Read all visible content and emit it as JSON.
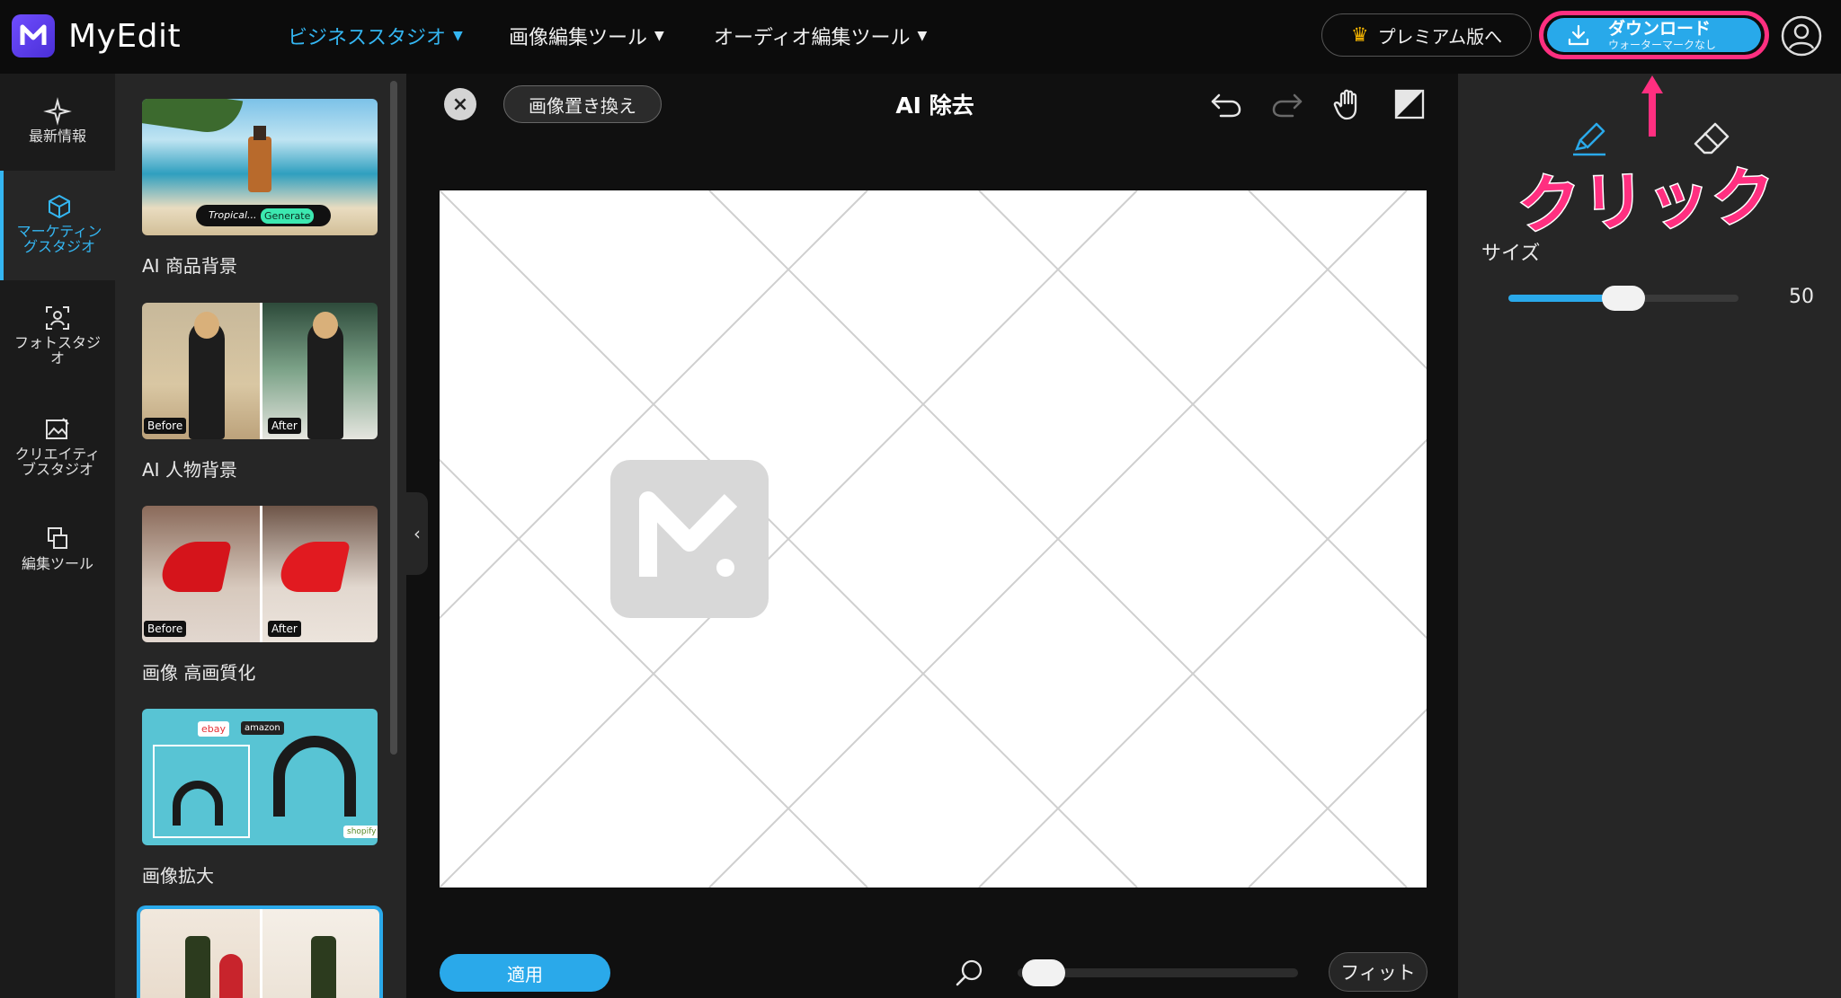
{
  "header": {
    "brand": "MyEdit",
    "nav": [
      {
        "label": "ビジネススタジオ",
        "active": true
      },
      {
        "label": "画像編集ツール"
      },
      {
        "label": "オーディオ編集ツール"
      }
    ],
    "premium_label": "プレミアム版へ",
    "download_label": "ダウンロード",
    "download_sub": "ウォーターマークなし"
  },
  "rail": [
    {
      "label": "最新情報",
      "icon": "sparkle-icon"
    },
    {
      "label": "マーケティングスタジオ",
      "icon": "cube-icon",
      "active": true
    },
    {
      "label": "フォトスタジオ",
      "icon": "portrait-scan-icon"
    },
    {
      "label": "クリエイティブスタジオ",
      "icon": "image-edit-icon"
    },
    {
      "label": "編集ツール",
      "icon": "layers-icon"
    }
  ],
  "tools": [
    {
      "label": "AI 商品背景",
      "thumb_tag_left": "Tropical...",
      "thumb_tag_right": "Generate"
    },
    {
      "label": "AI 人物背景",
      "before": "Before",
      "after": "After"
    },
    {
      "label": "画像 高画質化",
      "before": "Before",
      "after": "After"
    },
    {
      "label": "画像拡大",
      "logos": [
        "ebay",
        "amazon",
        "shopify"
      ]
    }
  ],
  "editor": {
    "title": "AI 除去",
    "replace_label": "画像置き換え",
    "apply_label": "適用",
    "fit_label": "フィット",
    "zoom_fraction": 0.02
  },
  "settings": {
    "size_label": "サイズ",
    "size_value": "50",
    "size_fraction": 0.5
  },
  "annotation": {
    "click_text": "クリック"
  },
  "colors": {
    "accent": "#2aa9ea",
    "annotation": "#ff2f80"
  }
}
